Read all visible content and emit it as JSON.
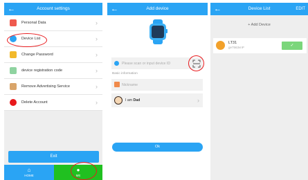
{
  "screen1": {
    "title": "Account settings",
    "back_icon": "←",
    "menu": [
      {
        "label": "Personal Data",
        "icon_color": "#ef5a4e",
        "icon": "person-icon"
      },
      {
        "label": "Device List",
        "icon_color": "#2aa4f4",
        "icon": "watch-icon"
      },
      {
        "label": "Change Password",
        "icon_color": "#f2b92b",
        "icon": "lock-icon"
      },
      {
        "label": "device registration code",
        "icon_color": "#8fd3a0",
        "icon": "qr-code-icon"
      },
      {
        "label": "Remove Advertising Service",
        "icon_color": "#d9a56a",
        "icon": "ad-icon"
      },
      {
        "label": "Delete Account",
        "icon_color": "#e8191c",
        "icon": "power-icon"
      }
    ],
    "chevron": "›",
    "exit_label": "Exit",
    "nav": {
      "home_label": "HOME",
      "me_label": "ME",
      "home_icon": "⌂",
      "me_icon": "●"
    }
  },
  "screen2": {
    "title": "Add device",
    "back_icon": "←",
    "scan_placeholder": "Please scan or input device ID",
    "section_label": "Basic information",
    "nickname_placeholder": "Nickname",
    "relation_prefix": "I am",
    "relation_value": "Dad",
    "chevron": "›",
    "ok_label": "Ok"
  },
  "screen3": {
    "title": "Device List",
    "back_icon": "←",
    "edit_label": "EDIT",
    "add_label": "+  Add Device",
    "devices": [
      {
        "name": "LT31",
        "id": "ge7563vnP",
        "check": "✓"
      }
    ]
  },
  "colors": {
    "accent_blue": "#2aa4f4",
    "nav_active_green": "#20c020",
    "annotation_red": "#e8191c"
  }
}
